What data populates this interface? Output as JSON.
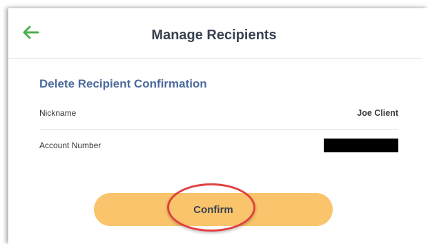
{
  "header": {
    "back_icon": "arrow-left-icon",
    "title": "Manage Recipients",
    "accent_color": "#4caf50"
  },
  "section": {
    "title": "Delete Recipient Confirmation"
  },
  "details": [
    {
      "label": "Nickname",
      "value": "Joe Client"
    },
    {
      "label": "Account Number",
      "value": ""
    }
  ],
  "actions": {
    "confirm_label": "Confirm",
    "confirm_color": "#f9c46b",
    "highlight_color": "#e0413f"
  }
}
